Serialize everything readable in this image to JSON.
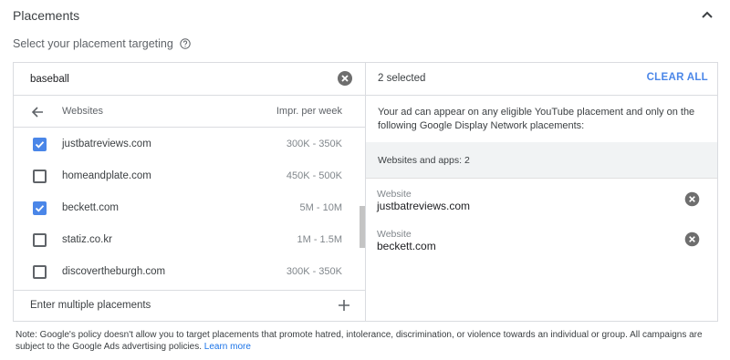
{
  "section": {
    "title": "Placements"
  },
  "targeting": {
    "label": "Select your placement targeting"
  },
  "search": {
    "value": "baseball"
  },
  "list": {
    "col_websites": "Websites",
    "col_impr": "Impr. per week",
    "items": [
      {
        "name": "justbatreviews.com",
        "impr": "300K - 350K",
        "checked": true
      },
      {
        "name": "homeandplate.com",
        "impr": "450K - 500K",
        "checked": false
      },
      {
        "name": "beckett.com",
        "impr": "5M - 10M",
        "checked": true
      },
      {
        "name": "statiz.co.kr",
        "impr": "1M - 1.5M",
        "checked": false
      },
      {
        "name": "discovertheburgh.com",
        "impr": "300K - 350K",
        "checked": false
      }
    ],
    "enter_multiple": "Enter multiple placements"
  },
  "selection": {
    "count": "2 selected",
    "clear_all": "CLEAR ALL",
    "description": "Your ad can appear on any eligible YouTube placement and only on the following Google Display Network placements:",
    "group_label": "Websites and apps: 2",
    "items": [
      {
        "type": "Website",
        "name": "justbatreviews.com"
      },
      {
        "type": "Website",
        "name": "beckett.com"
      }
    ]
  },
  "note": {
    "text": "Note: Google's policy doesn't allow you to target placements that promote hatred, intolerance, discrimination, or violence towards an individual or group. All campaigns are subject to the Google Ads advertising policies.",
    "link": "Learn more"
  },
  "colors": {
    "accent": "#4a86e8",
    "border": "#dadce0",
    "group_bg": "#f1f3f4"
  },
  "icons": [
    "chevron-up-icon",
    "help-icon",
    "clear-search-icon",
    "back-arrow-icon",
    "check-icon",
    "add-icon",
    "remove-icon"
  ]
}
